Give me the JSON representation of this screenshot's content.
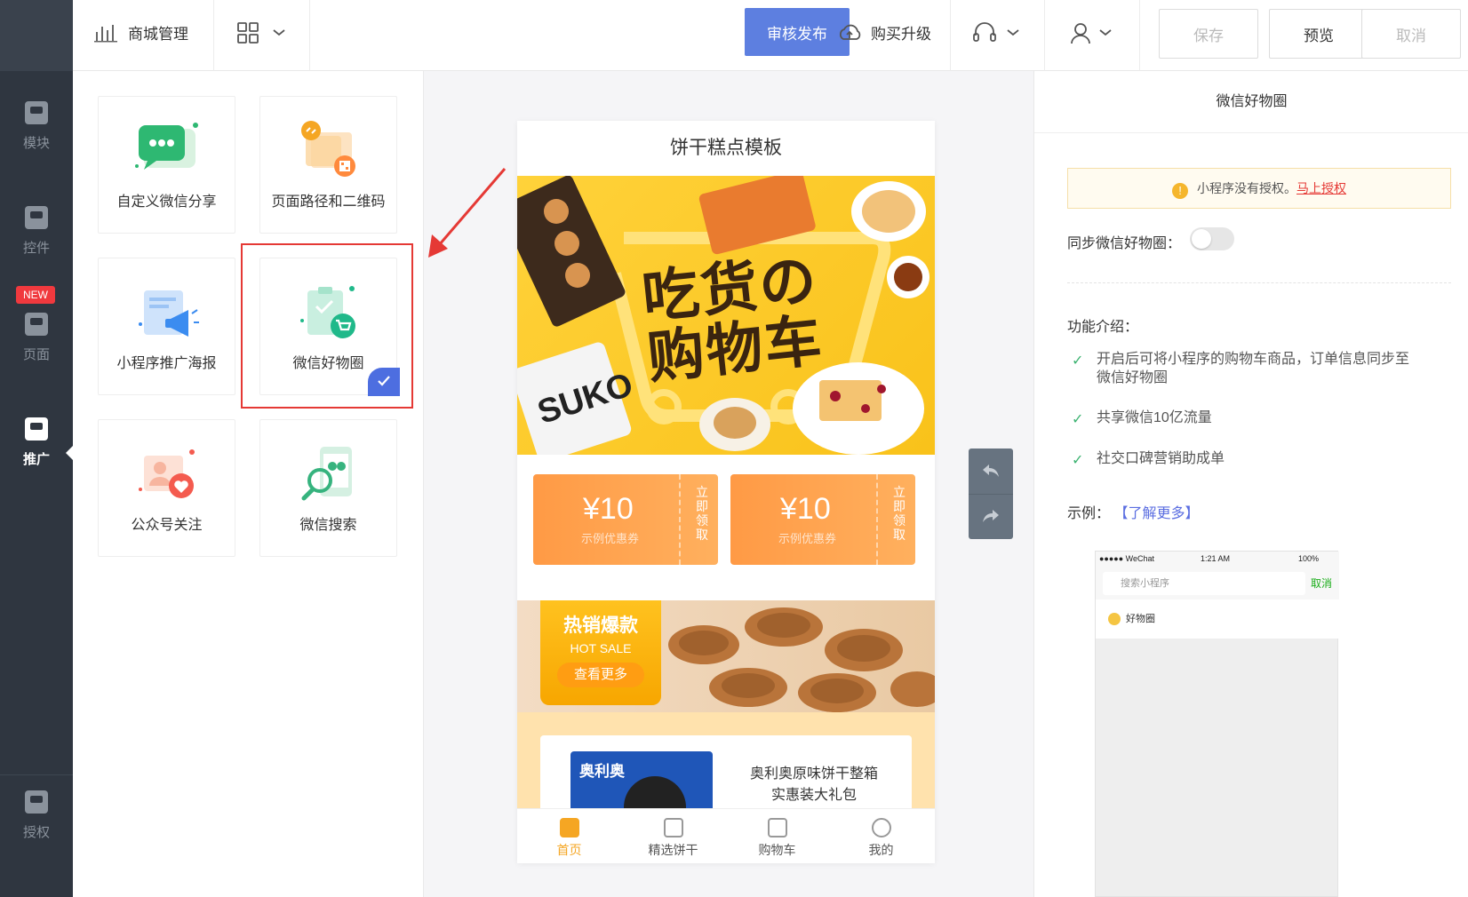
{
  "sidebar": {
    "items": [
      {
        "label": "模块"
      },
      {
        "label": "控件"
      },
      {
        "label": "页面"
      },
      {
        "label": "推广"
      },
      {
        "label": "授权"
      }
    ],
    "new_badge": "NEW"
  },
  "topbar": {
    "store_label": "商城管理",
    "publish_label": "审核发布",
    "upgrade_label": "购买升级",
    "save_label": "保存",
    "preview_label": "预览",
    "cancel_label": "取消"
  },
  "widgets": [
    {
      "label": "自定义微信分享"
    },
    {
      "label": "页面路径和二维码"
    },
    {
      "label": "小程序推广海报"
    },
    {
      "label": "微信好物圈"
    },
    {
      "label": "公众号关注"
    },
    {
      "label": "微信搜索"
    }
  ],
  "canvas": {
    "title": "饼干糕点模板",
    "banner_line1": "吃货の",
    "banner_line2": "购物车",
    "banner_brand": "SUKO",
    "coupons": [
      {
        "amount": "¥10",
        "sub": "示例优惠券",
        "action": "立即领取"
      },
      {
        "amount": "¥10",
        "sub": "示例优惠券",
        "action": "立即领取"
      }
    ],
    "hot": {
      "title": "热销爆款",
      "sub": "HOT SALE",
      "button": "查看更多"
    },
    "product": {
      "name_line1": "奥利奥原味饼干整箱",
      "name_line2": "实惠装大礼包",
      "pack_text": "奥利奥"
    },
    "tabs": [
      {
        "label": "首页"
      },
      {
        "label": "精选饼干"
      },
      {
        "label": "购物车"
      },
      {
        "label": "我的"
      }
    ]
  },
  "right_panel": {
    "title": "微信好物圈",
    "warning_text": "小程序没有授权。",
    "warning_link": "马上授权",
    "sync_label": "同步微信好物圈：",
    "sync_enabled": false,
    "intro_label": "功能介绍：",
    "features": [
      {
        "line1": "开启后可将小程序的购物车商品，订单信息同步至",
        "line2": "微信好物圈"
      },
      {
        "line1": "共享微信10亿流量",
        "line2": ""
      },
      {
        "line1": "社交口碑营销助成单",
        "line2": ""
      }
    ],
    "example_label": "示例：",
    "example_link": "【了解更多】",
    "screenshot": {
      "carrier": "●●●●● WeChat",
      "time": "1:21 AM",
      "battery": "100%",
      "search_placeholder": "搜索小程序",
      "cancel": "取消",
      "row_label": "好物圈"
    }
  },
  "colors": {
    "accent": "#5d7fe0",
    "rail": "#2f3640",
    "highlight": "#e53935",
    "coupon": "#ff9a45"
  }
}
